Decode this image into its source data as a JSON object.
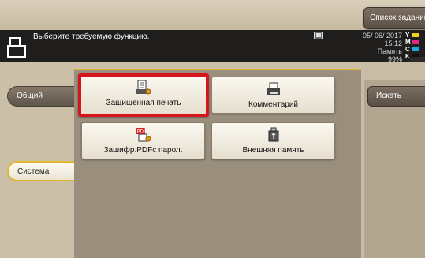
{
  "header": {
    "job_list_label": "Список заданий",
    "message": "Выберите требуемую функцию.",
    "date": "05/ 06/ 2017",
    "time": "15:12",
    "memory_label": "Память",
    "memory_value": "99%",
    "toner": [
      {
        "letter": "Y",
        "color": "#f2d21b"
      },
      {
        "letter": "M",
        "color": "#e02685"
      },
      {
        "letter": "C",
        "color": "#1aa5e0"
      },
      {
        "letter": "K",
        "color": "#111111"
      }
    ],
    "collapse_label": "«"
  },
  "tabs": {
    "general": "Общий",
    "system": "Система"
  },
  "functions": {
    "secure_print": "Защищенная печать",
    "comment": "Комментарий",
    "encrypted_pdf": "Зашифр.PDFс парол.",
    "external_memory": "Внешняя память"
  },
  "right_panel": {
    "search_label": "Искать"
  },
  "icons": {
    "printer": "printer-icon",
    "secure_print": "secure-print-icon",
    "comment": "comment-print-icon",
    "pdf": "pdf-lock-icon",
    "memory": "usb-memory-icon"
  },
  "colors": {
    "highlight": "#d5141c",
    "accent": "#e1b52d",
    "header_bg": "#1f1e1c"
  }
}
